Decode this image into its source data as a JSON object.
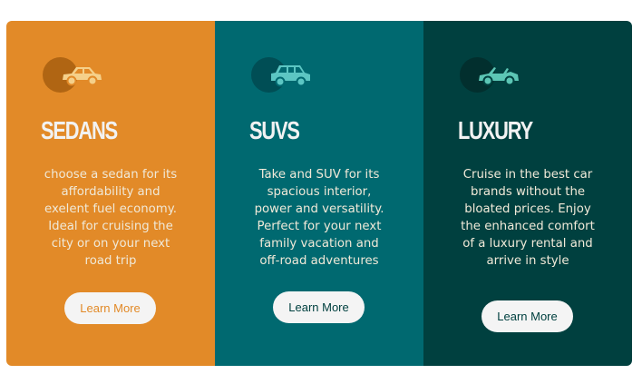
{
  "cards": [
    {
      "title": "Sedans",
      "icon": "sedan-car-icon",
      "description": "choose a sedan for its affordability and exelent fuel economy. Ideal for cruising the city or on your next road trip",
      "button": "Learn More",
      "colors": {
        "background": "#E28A28",
        "iconCircle": "#B06513",
        "iconCar": "#F5D08A",
        "buttonText": "#E28A28"
      }
    },
    {
      "title": "SUVs",
      "icon": "suv-icon",
      "description": "Take and SUV for its spacious interior, power and versatility. Perfect for your next family vacation and off-road adventures",
      "button": "Learn More",
      "colors": {
        "background": "#006970",
        "iconCircle": "#004E55",
        "iconCar": "#5CC6C3",
        "buttonText": "#00403F"
      }
    },
    {
      "title": "Luxury",
      "icon": "convertible-car-icon",
      "description": "Cruise in the best car brands without the bloated prices. Enjoy the enhanced comfort of a luxury rental and arrive in style",
      "button": "Learn More",
      "colors": {
        "background": "#00403F",
        "iconCircle": "#022F2E",
        "iconCar": "#5CC6B5",
        "buttonText": "#00403F"
      }
    }
  ]
}
